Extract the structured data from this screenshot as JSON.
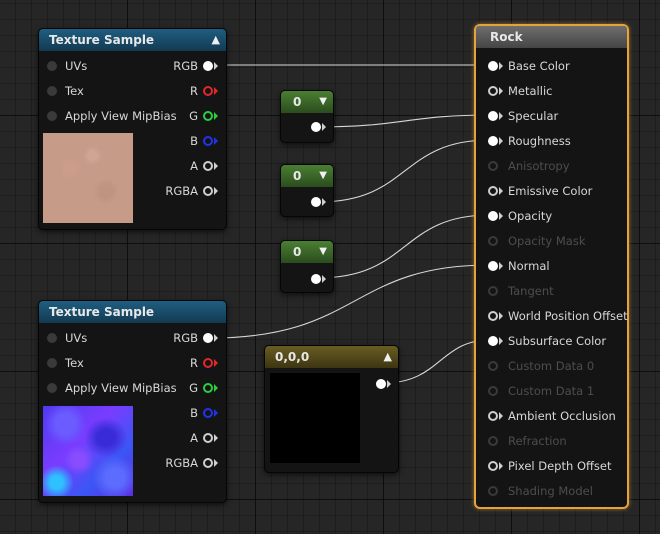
{
  "texture_sample_1": {
    "title": "Texture Sample",
    "inputs": [
      "UVs",
      "Tex",
      "Apply View MipBias"
    ],
    "outputs": [
      "RGB",
      "R",
      "G",
      "B",
      "A",
      "RGBA"
    ]
  },
  "texture_sample_2": {
    "title": "Texture Sample",
    "inputs": [
      "UVs",
      "Tex",
      "Apply View MipBias"
    ],
    "outputs": [
      "RGB",
      "R",
      "G",
      "B",
      "A",
      "RGBA"
    ]
  },
  "constants": [
    {
      "value": "0"
    },
    {
      "value": "0"
    },
    {
      "value": "0"
    }
  ],
  "vector_constant": {
    "value": "0,0,0"
  },
  "material": {
    "title": "Rock",
    "pins": [
      {
        "label": "Base Color"
      },
      {
        "label": "Metallic"
      },
      {
        "label": "Specular"
      },
      {
        "label": "Roughness"
      },
      {
        "label": "Anisotropy"
      },
      {
        "label": "Emissive Color"
      },
      {
        "label": "Opacity"
      },
      {
        "label": "Opacity Mask"
      },
      {
        "label": "Normal"
      },
      {
        "label": "Tangent"
      },
      {
        "label": "World Position Offset"
      },
      {
        "label": "Subsurface Color"
      },
      {
        "label": "Custom Data 0"
      },
      {
        "label": "Custom Data 1"
      },
      {
        "label": "Ambient Occlusion"
      },
      {
        "label": "Refraction"
      },
      {
        "label": "Pixel Depth Offset"
      },
      {
        "label": "Shading Model"
      }
    ]
  }
}
